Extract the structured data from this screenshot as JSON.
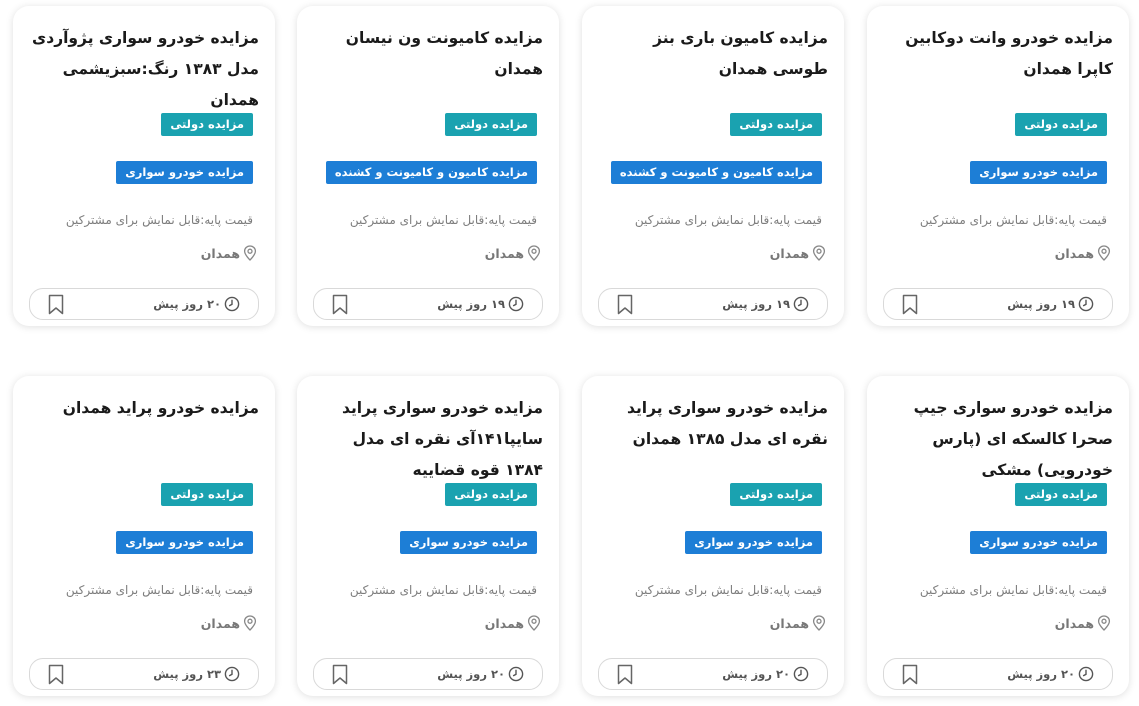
{
  "colors": {
    "gov_badge": "#1aa2b0",
    "category_badge": "#1d7ed6"
  },
  "cards": [
    {
      "title": "مزایده خودرو وانت دوکابین کاپرا همدان",
      "gov_label": "مزایده دولتی",
      "category_label": "مزایده خودرو سواری",
      "price": "قیمت پایه:قابل نمایش برای مشترکین",
      "location": "همدان",
      "time": "۱۹ روز پیش",
      "location_icon": "location-pin-icon",
      "clock_icon": "clock-icon",
      "bookmark_icon": "bookmark-icon"
    },
    {
      "title": "مزایده کامیون باری بنز طوسی همدان",
      "gov_label": "مزایده دولتی",
      "category_label": "مزایده کامیون و کامیونت و کشنده",
      "price": "قیمت پایه:قابل نمایش برای مشترکین",
      "location": "همدان",
      "time": "۱۹ روز پیش",
      "location_icon": "location-pin-icon",
      "clock_icon": "clock-icon",
      "bookmark_icon": "bookmark-icon"
    },
    {
      "title": "مزایده کامیونت ون نیسان همدان",
      "gov_label": "مزایده دولتی",
      "category_label": "مزایده کامیون و کامیونت و کشنده",
      "price": "قیمت پایه:قابل نمایش برای مشترکین",
      "location": "همدان",
      "time": "۱۹ روز پیش",
      "location_icon": "location-pin-icon",
      "clock_icon": "clock-icon",
      "bookmark_icon": "bookmark-icon"
    },
    {
      "title": "مزایده خودرو سواری پژوآردی مدل ۱۳۸۳ رنگ:سبزیشمی همدان",
      "gov_label": "مزایده دولتی",
      "category_label": "مزایده خودرو سواری",
      "price": "قیمت پایه:قابل نمایش برای مشترکین",
      "location": "همدان",
      "time": "۲۰ روز پیش",
      "location_icon": "location-pin-icon",
      "clock_icon": "clock-icon",
      "bookmark_icon": "bookmark-icon"
    },
    {
      "title": "مزایده خودرو سواری جیپ صحرا کالسکه ای (پارس خودرویی) مشکی",
      "gov_label": "مزایده دولتی",
      "category_label": "مزایده خودرو سواری",
      "price": "قیمت پایه:قابل نمایش برای مشترکین",
      "location": "همدان",
      "time": "۲۰ روز پیش",
      "location_icon": "location-pin-icon",
      "clock_icon": "clock-icon",
      "bookmark_icon": "bookmark-icon"
    },
    {
      "title": "مزایده خودرو سواری پراید نقره ای مدل ۱۳۸۵ همدان",
      "gov_label": "مزایده دولتی",
      "category_label": "مزایده خودرو سواری",
      "price": "قیمت پایه:قابل نمایش برای مشترکین",
      "location": "همدان",
      "time": "۲۰ روز پیش",
      "location_icon": "location-pin-icon",
      "clock_icon": "clock-icon",
      "bookmark_icon": "bookmark-icon"
    },
    {
      "title": "مزایده خودرو سواری پراید سایپا۱۴۱آی نقره ای مدل ۱۳۸۴ قوه قضاییه",
      "gov_label": "مزایده دولتی",
      "category_label": "مزایده خودرو سواری",
      "price": "قیمت پایه:قابل نمایش برای مشترکین",
      "location": "همدان",
      "time": "۲۰ روز پیش",
      "location_icon": "location-pin-icon",
      "clock_icon": "clock-icon",
      "bookmark_icon": "bookmark-icon"
    },
    {
      "title": "مزایده خودرو پراید همدان",
      "gov_label": "مزایده دولتی",
      "category_label": "مزایده خودرو سواری",
      "price": "قیمت پایه:قابل نمایش برای مشترکین",
      "location": "همدان",
      "time": "۲۳ روز پیش",
      "location_icon": "location-pin-icon",
      "clock_icon": "clock-icon",
      "bookmark_icon": "bookmark-icon"
    }
  ]
}
